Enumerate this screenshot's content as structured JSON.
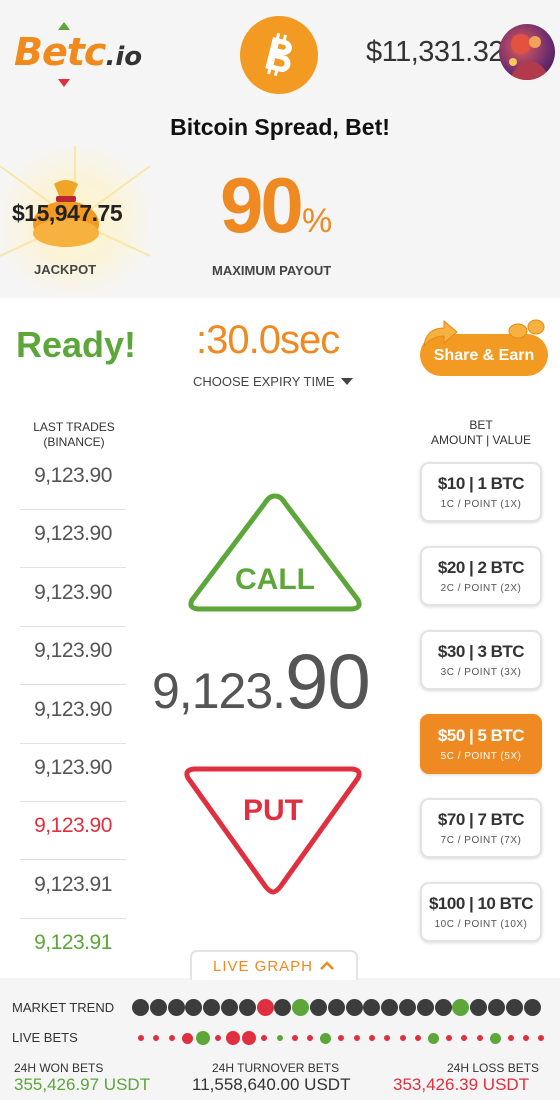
{
  "header": {
    "logo_text": "Betc",
    "logo_tld": ".io",
    "coin_icon": "bitcoin-icon",
    "balance": "$11,331.32",
    "avatar_icon": "user-avatar"
  },
  "headline": "Bitcoin Spread, Bet!",
  "jackpot": {
    "amount": "$15,947.75",
    "label": "JACKPOT"
  },
  "payout": {
    "value": "90",
    "percent": "%",
    "label": "MAXIMUM PAYOUT"
  },
  "status": {
    "ready": "Ready!",
    "timer": ":30.0sec",
    "expiry_label": "CHOOSE EXPIRY TIME",
    "share_label": "Share & Earn"
  },
  "trades": {
    "header_line1": "LAST TRADES",
    "header_line2": "(BINANCE)",
    "items": [
      {
        "value": "9,123.90",
        "color": "#555555"
      },
      {
        "value": "9,123.90",
        "color": "#555555"
      },
      {
        "value": "9,123.90",
        "color": "#555555"
      },
      {
        "value": "9,123.90",
        "color": "#555555"
      },
      {
        "value": "9,123.90",
        "color": "#555555"
      },
      {
        "value": "9,123.90",
        "color": "#555555"
      },
      {
        "value": "9,123.90",
        "color": "#e0303f"
      },
      {
        "value": "9,123.91",
        "color": "#555555"
      },
      {
        "value": "9,123.91",
        "color": "#5ca63a"
      }
    ]
  },
  "trade_buttons": {
    "call": "CALL",
    "put": "PUT",
    "call_color": "#5ca63a",
    "put_color": "#e0303f"
  },
  "price": {
    "main": "9,123.",
    "decimals": "90"
  },
  "bets": {
    "header_line1": "BET",
    "header_line2": "AMOUNT | VALUE",
    "items": [
      {
        "main": "$10  | 1 BTC",
        "sub": "1C / POINT (1X)",
        "active": false
      },
      {
        "main": "$20  | 2 BTC",
        "sub": "2C / POINT (2X)",
        "active": false
      },
      {
        "main": "$30  | 3 BTC",
        "sub": "3C / POINT (3X)",
        "active": false
      },
      {
        "main": "$50  | 5 BTC",
        "sub": "5C / POINT (5X)",
        "active": true
      },
      {
        "main": "$70  | 7 BTC",
        "sub": "7C / POINT (7X)",
        "active": false
      },
      {
        "main": "$100  | 10 BTC",
        "sub": "10C / POINT (10X)",
        "active": false
      }
    ]
  },
  "live_graph_label": "LIVE GRAPH",
  "market_trend": {
    "label": "MARKET TREND",
    "dots": [
      "dark",
      "dark",
      "dark",
      "dark",
      "dark",
      "dark",
      "dark",
      "red",
      "dark",
      "green",
      "dark",
      "dark",
      "dark",
      "dark",
      "dark",
      "dark",
      "dark",
      "dark",
      "green",
      "dark",
      "dark",
      "dark",
      "dark"
    ]
  },
  "live_bets": {
    "label": "LIVE BETS",
    "dots": [
      {
        "c": "red",
        "s": "s"
      },
      {
        "c": "red",
        "s": "s"
      },
      {
        "c": "red",
        "s": "s"
      },
      {
        "c": "red",
        "s": "m"
      },
      {
        "c": "green",
        "s": "l"
      },
      {
        "c": "red",
        "s": "s"
      },
      {
        "c": "red",
        "s": "l"
      },
      {
        "c": "red",
        "s": "l"
      },
      {
        "c": "red",
        "s": "s"
      },
      {
        "c": "green",
        "s": "s"
      },
      {
        "c": "red",
        "s": "s"
      },
      {
        "c": "red",
        "s": "s"
      },
      {
        "c": "green",
        "s": "m"
      },
      {
        "c": "red",
        "s": "s"
      },
      {
        "c": "red",
        "s": "s"
      },
      {
        "c": "red",
        "s": "s"
      },
      {
        "c": "red",
        "s": "s"
      },
      {
        "c": "red",
        "s": "s"
      },
      {
        "c": "red",
        "s": "s"
      },
      {
        "c": "green",
        "s": "m"
      },
      {
        "c": "red",
        "s": "s"
      },
      {
        "c": "red",
        "s": "s"
      },
      {
        "c": "red",
        "s": "s"
      },
      {
        "c": "green",
        "s": "m"
      },
      {
        "c": "red",
        "s": "s"
      },
      {
        "c": "red",
        "s": "s"
      },
      {
        "c": "red",
        "s": "s"
      }
    ]
  },
  "stats": {
    "won_label": "24H WON BETS",
    "won_value": "355,426.97 USDT",
    "turnover_label": "24H TURNOVER BETS",
    "turnover_value": "11,558,640.00 USDT",
    "loss_label": "24H LOSS BETS",
    "loss_value": "353,426.39 USDT"
  },
  "colors": {
    "orange": "#ef8a23",
    "green": "#5ca63a",
    "red": "#e0303f",
    "dark_dot": "#3c3c3c"
  }
}
